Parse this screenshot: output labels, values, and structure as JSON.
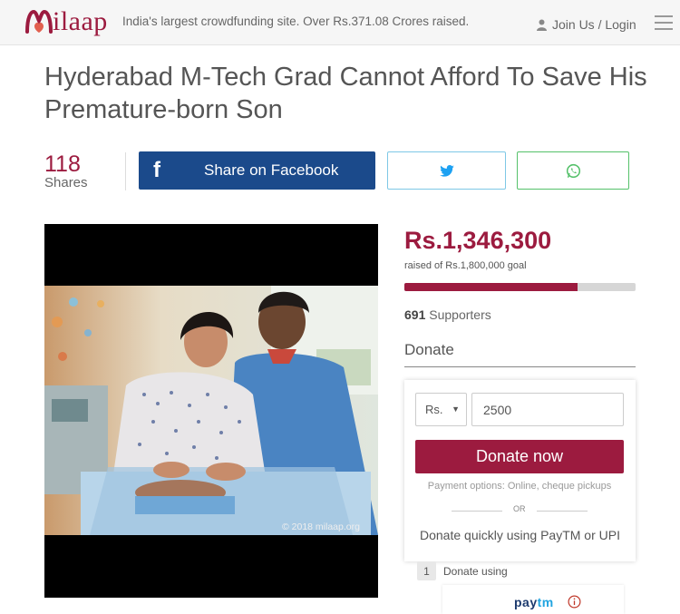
{
  "header": {
    "logo_text": "ilaap",
    "tagline": "India's largest crowdfunding site. Over Rs.371.08 Crores raised.",
    "login_label": "Join Us / Login"
  },
  "campaign": {
    "title": "Hyderabad M-Tech Grad Cannot Afford To Save His Premature-born Son"
  },
  "share": {
    "count": "118",
    "count_label": "Shares",
    "facebook_label": "Share on Facebook"
  },
  "media": {
    "copyright": "© 2018 milaap.org"
  },
  "fundraising": {
    "raised": "Rs.1,346,300",
    "goal_text": "raised of Rs.1,800,000 goal",
    "progress_fraction": 0.748,
    "supporters_count": "691",
    "supporters_label": "Supporters"
  },
  "donate": {
    "heading": "Donate",
    "currency": "Rs.",
    "amount": "2500",
    "button_label": "Donate now",
    "payment_options": "Payment options: Online, cheque pickups",
    "or_label": "OR",
    "quick_label": "Donate quickly using PayTM or UPI",
    "step_number": "1",
    "step_label": "Donate using",
    "paytm_pay": "pay",
    "paytm_tm": "tm"
  },
  "colors": {
    "brand": "#9c1b3f",
    "facebook": "#1b4a8b",
    "twitter": "#1da1f2",
    "whatsapp": "#55c16a"
  },
  "icons": [
    "milaap-logo-icon",
    "user-icon",
    "menu-icon",
    "facebook-icon",
    "twitter-icon",
    "whatsapp-icon",
    "info-icon"
  ]
}
